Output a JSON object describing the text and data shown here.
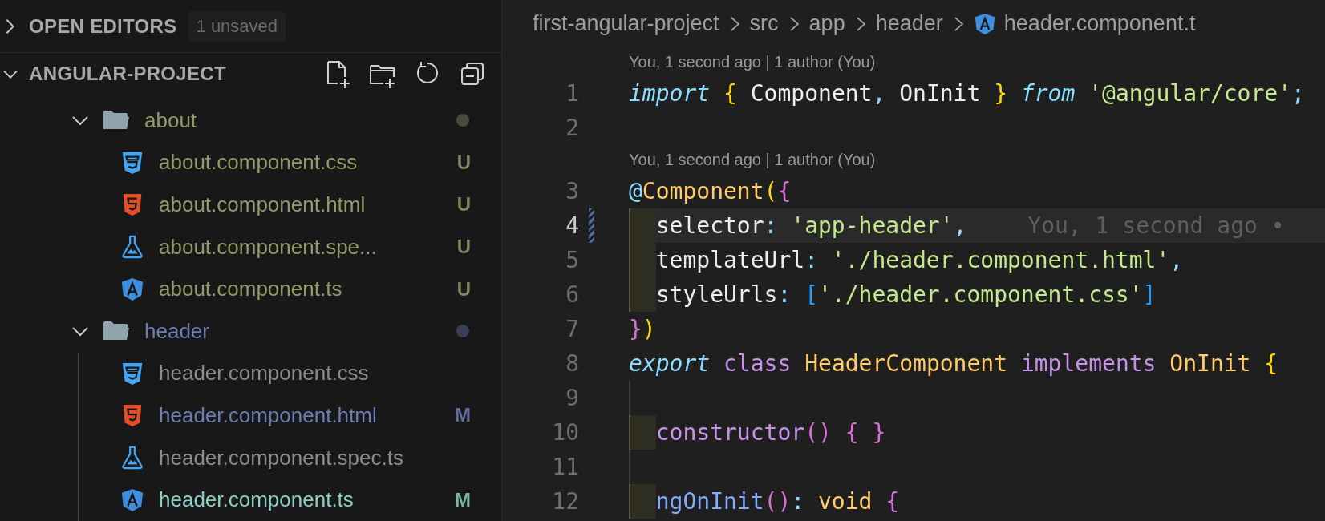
{
  "sidebar": {
    "open_editors": {
      "title": "OPEN EDITORS",
      "expanded": false,
      "badge": "1 unsaved"
    },
    "project": {
      "title": "ANGULAR-PROJECT",
      "expanded": true,
      "actions": [
        {
          "kind": "new-file"
        },
        {
          "kind": "new-folder"
        },
        {
          "kind": "refresh"
        },
        {
          "kind": "collapse"
        }
      ]
    },
    "tree": [
      {
        "kind": "folder",
        "name": "about",
        "expanded": true,
        "color": "#8f9c6a",
        "children": [
          {
            "kind": "css",
            "name": "about.component.css",
            "badge": "U",
            "color": "#8f9c6a"
          },
          {
            "kind": "html",
            "name": "about.component.html",
            "badge": "U",
            "color": "#8f9c6a"
          },
          {
            "kind": "spec",
            "name": "about.component.spe...",
            "badge": "U",
            "color": "#8f9c6a"
          },
          {
            "kind": "angular",
            "name": "about.component.ts",
            "badge": "U",
            "color": "#8f9c6a"
          }
        ]
      },
      {
        "kind": "folder",
        "name": "header",
        "expanded": true,
        "color": "#6b7db3",
        "children": [
          {
            "kind": "css",
            "name": "header.component.css",
            "color": "#8c8c8c"
          },
          {
            "kind": "html",
            "name": "header.component.html",
            "badge": "M",
            "color": "#6b7db3"
          },
          {
            "kind": "spec",
            "name": "header.component.spec.ts",
            "color": "#8c8c8c"
          },
          {
            "kind": "angular",
            "name": "header.component.ts",
            "badge": "M",
            "color": "#8ccfc6"
          }
        ]
      }
    ]
  },
  "editor": {
    "breadcrumbs": [
      {
        "kind": "folder",
        "text": "first-angular-project"
      },
      {
        "kind": "folder",
        "text": "src"
      },
      {
        "kind": "folder",
        "text": "app"
      },
      {
        "kind": "folder",
        "text": "header"
      },
      {
        "kind": "angular",
        "text": "header.component.t"
      }
    ],
    "lines": [
      {
        "kind": "codelens",
        "text": "You, 1 second ago | 1 author (You)"
      },
      {
        "kind": "code",
        "number": "1",
        "tokens": [
          {
            "text": "import ",
            "kind": "keyword-italic"
          },
          {
            "text": "{",
            "kind": "bracket-1"
          },
          {
            "text": " Component",
            "kind": "plain"
          },
          {
            "text": ",",
            "kind": "punct"
          },
          {
            "text": " OnInit ",
            "kind": "plain"
          },
          {
            "text": "}",
            "kind": "bracket-1"
          },
          {
            "text": " from ",
            "kind": "keyword-italic"
          },
          {
            "text": "'@angular/core'",
            "kind": "string"
          },
          {
            "text": ";",
            "kind": "punct"
          }
        ]
      },
      {
        "kind": "code",
        "number": "2"
      },
      {
        "kind": "codelens",
        "text": "You, 1 second ago | 1 author (You)"
      },
      {
        "kind": "code",
        "number": "3",
        "tokens": [
          {
            "text": "@",
            "kind": "punct"
          },
          {
            "text": "Component",
            "kind": "type"
          },
          {
            "text": "(",
            "kind": "bracket-1"
          },
          {
            "text": "{",
            "kind": "bracket-2"
          }
        ]
      },
      {
        "kind": "code",
        "number": "4",
        "active": true,
        "modified": true,
        "guide": {
          "kind": "highlight"
        },
        "tokens": [
          {
            "text": "selector",
            "kind": "plain"
          },
          {
            "text": ": ",
            "kind": "punct"
          },
          {
            "text": "'app-header'",
            "kind": "string"
          },
          {
            "text": ",",
            "kind": "punct"
          }
        ],
        "blame": "You, 1 second ago •"
      },
      {
        "kind": "code",
        "number": "5",
        "guide": {
          "kind": "highlight"
        },
        "tokens": [
          {
            "text": "templateUrl",
            "kind": "plain"
          },
          {
            "text": ": ",
            "kind": "punct"
          },
          {
            "text": "'./header.component.html'",
            "kind": "string"
          },
          {
            "text": ",",
            "kind": "punct"
          }
        ]
      },
      {
        "kind": "code",
        "number": "6",
        "guide": {
          "kind": "highlight"
        },
        "tokens": [
          {
            "text": "styleUrls",
            "kind": "plain"
          },
          {
            "text": ": ",
            "kind": "punct"
          },
          {
            "text": "[",
            "kind": "bracket-3"
          },
          {
            "text": "'./header.component.css'",
            "kind": "string"
          },
          {
            "text": "]",
            "kind": "bracket-3"
          }
        ]
      },
      {
        "kind": "code",
        "number": "7",
        "tokens": [
          {
            "text": "}",
            "kind": "bracket-2"
          },
          {
            "text": ")",
            "kind": "bracket-1"
          }
        ]
      },
      {
        "kind": "code",
        "number": "8",
        "tokens": [
          {
            "text": "export ",
            "kind": "keyword-italic"
          },
          {
            "text": "class ",
            "kind": "keyword"
          },
          {
            "text": "HeaderComponent ",
            "kind": "type"
          },
          {
            "text": "implements ",
            "kind": "keyword"
          },
          {
            "text": "OnInit ",
            "kind": "type"
          },
          {
            "text": "{",
            "kind": "bracket-1"
          }
        ]
      },
      {
        "kind": "code",
        "number": "9",
        "guide": {
          "kind": "line"
        }
      },
      {
        "kind": "code",
        "number": "10",
        "guide": {
          "kind": "highlight"
        },
        "tokens": [
          {
            "text": "constructor",
            "kind": "keyword"
          },
          {
            "text": "() { }",
            "kind": "bracket-2"
          }
        ]
      },
      {
        "kind": "code",
        "number": "11",
        "guide": {
          "kind": "line"
        }
      },
      {
        "kind": "code",
        "number": "12",
        "guide": {
          "kind": "highlight"
        },
        "tokens": [
          {
            "text": "ngOnInit",
            "kind": "function"
          },
          {
            "text": "()",
            "kind": "bracket-2"
          },
          {
            "text": ": ",
            "kind": "punct"
          },
          {
            "text": "void ",
            "kind": "type"
          },
          {
            "text": "{",
            "kind": "bracket-2"
          }
        ]
      }
    ]
  }
}
